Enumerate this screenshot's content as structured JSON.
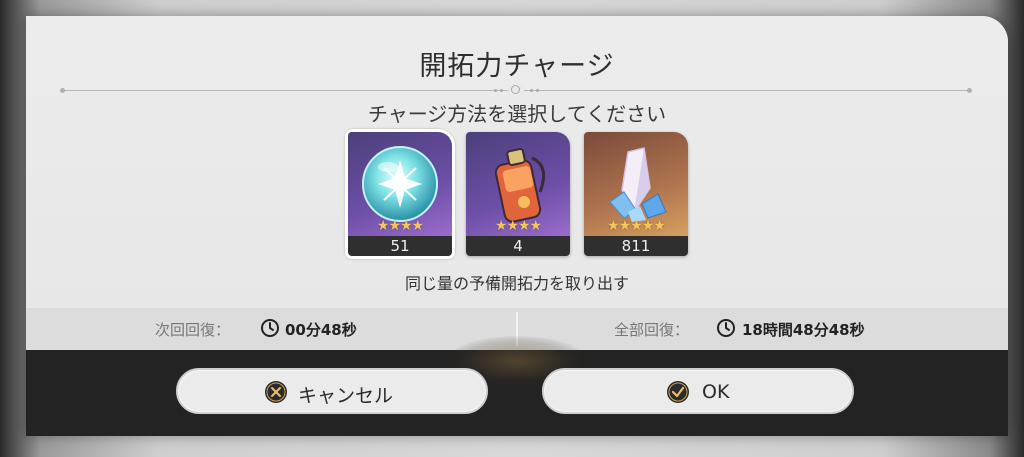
{
  "dialog": {
    "title": "開拓力チャージ",
    "subtitle": "チャージ方法を選択してください",
    "caption": "同じ量の予備開拓力を取り出す"
  },
  "items": [
    {
      "name": "燃料 orb",
      "count": "51",
      "stars": "★★★★",
      "selected": true
    },
    {
      "name": "bottle",
      "count": "4",
      "stars": "★★★★",
      "selected": false
    },
    {
      "name": "crystal",
      "count": "811",
      "stars": "★★★★★",
      "selected": false
    }
  ],
  "recovery": {
    "next_label": "次回回復：",
    "next_value": "00分48秒",
    "full_label": "全部回復：",
    "full_value": "18時間48分48秒"
  },
  "buttons": {
    "cancel_label": "キャンセル",
    "ok_label": "OK"
  },
  "colors": {
    "accent_gold": "#f6c657",
    "footer": "#232323",
    "panel": "#e8e8e8"
  }
}
